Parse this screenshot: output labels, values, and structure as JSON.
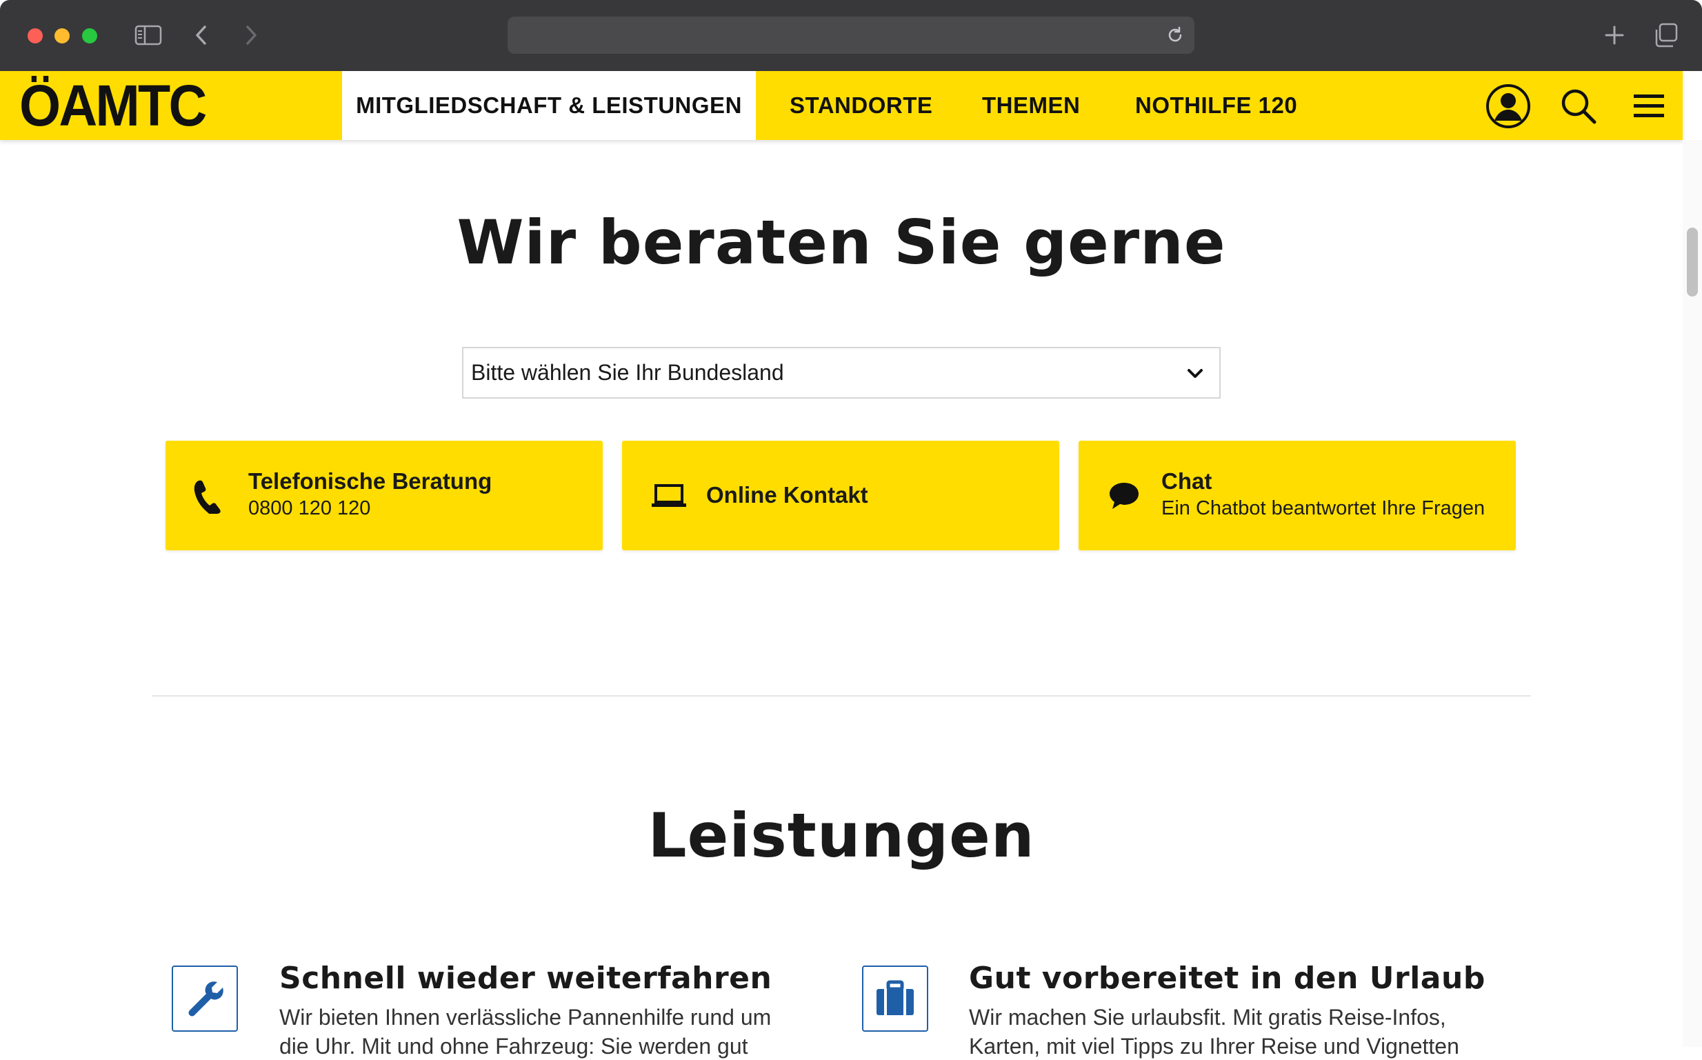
{
  "header": {
    "logo": "ÖAMTC",
    "nav": [
      "MITGLIEDSCHAFT & LEISTUNGEN",
      "STANDORTE",
      "THEMEN",
      "NOTHILFE 120"
    ]
  },
  "contact": {
    "title": "Wir beraten Sie gerne",
    "select_value": "Bitte wählen Sie Ihr Bundesland",
    "cards": [
      {
        "title": "Telefonische Beratung",
        "subtitle": "0800 120 120",
        "icon": "phone-icon"
      },
      {
        "title": "Online Kontakt",
        "subtitle": "",
        "icon": "laptop-icon"
      },
      {
        "title": "Chat",
        "subtitle": "Ein Chatbot beantwortet Ihre Fragen",
        "icon": "chat-bubble-icon"
      }
    ]
  },
  "services": {
    "title": "Leistungen",
    "items": [
      {
        "title": "Schnell wieder weiterfahren",
        "line1": "Wir bieten Ihnen verlässliche Pannenhilfe rund um",
        "line2": "die Uhr. Mit und ohne Fahrzeug: Sie werden gut",
        "icon": "wrench-icon"
      },
      {
        "title": "Gut vorbereitet in den Urlaub",
        "line1": "Wir machen Sie urlaubsfit. Mit gratis Reise-Infos,",
        "line2": "Karten, mit viel Tipps zu Ihrer Reise und Vignetten",
        "icon": "suitcase-icon"
      }
    ]
  },
  "colors": {
    "brand_yellow": "#ffdd00",
    "icon_blue": "#1f5fa8",
    "text_dark": "#1a1a1a"
  }
}
